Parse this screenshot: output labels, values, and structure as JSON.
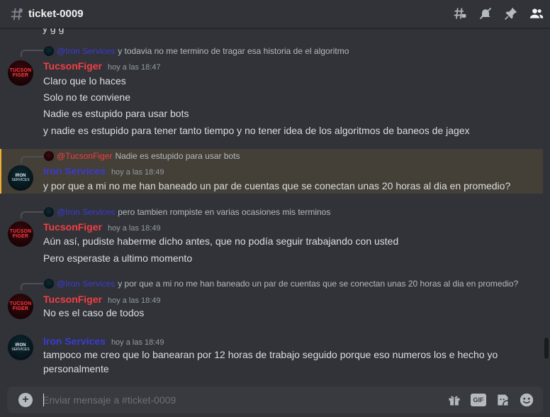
{
  "channel": {
    "name": "ticket-0009"
  },
  "colors": {
    "tucson": "#f23f43",
    "iron": "#3b3bd4",
    "mention_bg": "#f0b132"
  },
  "header_icons": [
    "threads-icon",
    "mute-icon",
    "pin-icon",
    "members-icon"
  ],
  "cut_line": "y                                    g                              g",
  "messages": [
    {
      "reply_name": "@Iron Services",
      "reply_text": "y todavia no me termino de tragar esa historia de el algoritmo",
      "author": "TucsonFiger",
      "time": "hoy a las 18:47",
      "lines": [
        "Claro que lo haces",
        "Solo no te conviene",
        "Nadie es estupido para usar bots",
        "y nadie es estupido para tener tanto tiempo y no tener idea de los algoritmos de baneos de jagex"
      ]
    },
    {
      "reply_name": "@TucsonFiger",
      "reply_text": "Nadie es estupido para usar bots",
      "author": "Iron Services",
      "time": "hoy a las 18:49",
      "lines": [
        "y por que a mi no me han baneado un par de cuentas que se conectan unas 20 horas al dia en promedio?"
      ]
    },
    {
      "reply_name": "@Iron Services",
      "reply_text": "pero tambien rompiste en varias ocasiones mis terminos",
      "author": "TucsonFiger",
      "time": "hoy a las 18:49",
      "lines": [
        "Aún así, pudiste haberme dicho antes, que no podía seguir trabajando con usted",
        "Pero esperaste a ultimo momento"
      ]
    },
    {
      "reply_name": "@Iron Services",
      "reply_text": "y por que a mi no me han baneado un par de cuentas que se conectan unas 20 horas al dia en promedio?",
      "author": "TucsonFiger",
      "time": "hoy a las 18:49",
      "lines": [
        "No es el caso de todos"
      ]
    },
    {
      "author": "Iron Services",
      "time": "hoy a las 18:49",
      "lines": [
        "tampoco me creo que lo banearan por 12 horas de trabajo seguido porque eso numeros los e hecho yo",
        "personalmente"
      ]
    }
  ],
  "avatars": {
    "tucson": {
      "line1": "TUCSON",
      "line2": "FIGER"
    },
    "iron": {
      "line1": "IRON",
      "line2": "SERVICES"
    }
  },
  "composer": {
    "placeholder": "Enviar mensaje a #ticket-0009",
    "gif_label": "GIF"
  }
}
